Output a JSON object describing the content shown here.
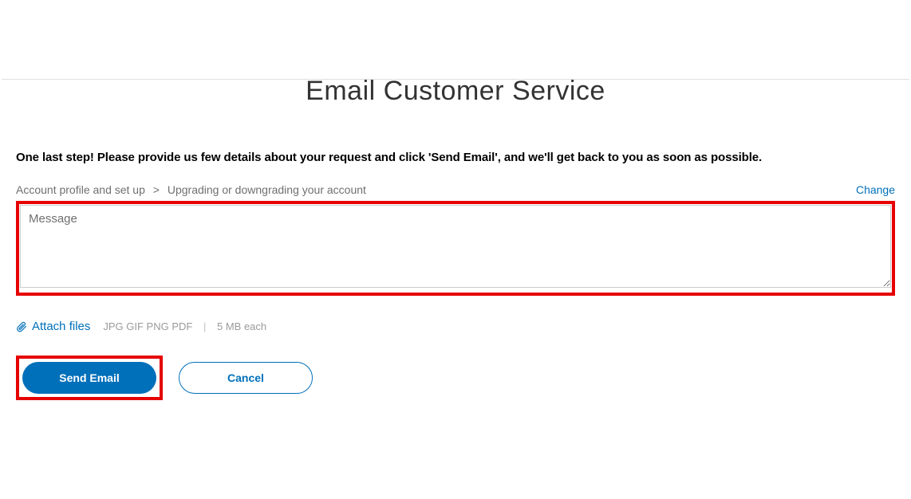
{
  "title": "Email Customer Service",
  "instruction": "One last step! Please provide us few details about your request and click 'Send Email', and we'll get back to you as soon as possible.",
  "breadcrumb": {
    "category": "Account profile and set up",
    "subcategory": "Upgrading or downgrading your account"
  },
  "change_label": "Change",
  "message": {
    "placeholder": "Message",
    "value": ""
  },
  "attach": {
    "label": "Attach files",
    "formats": "JPG GIF PNG PDF",
    "limit": "5 MB each"
  },
  "buttons": {
    "send": "Send Email",
    "cancel": "Cancel"
  }
}
